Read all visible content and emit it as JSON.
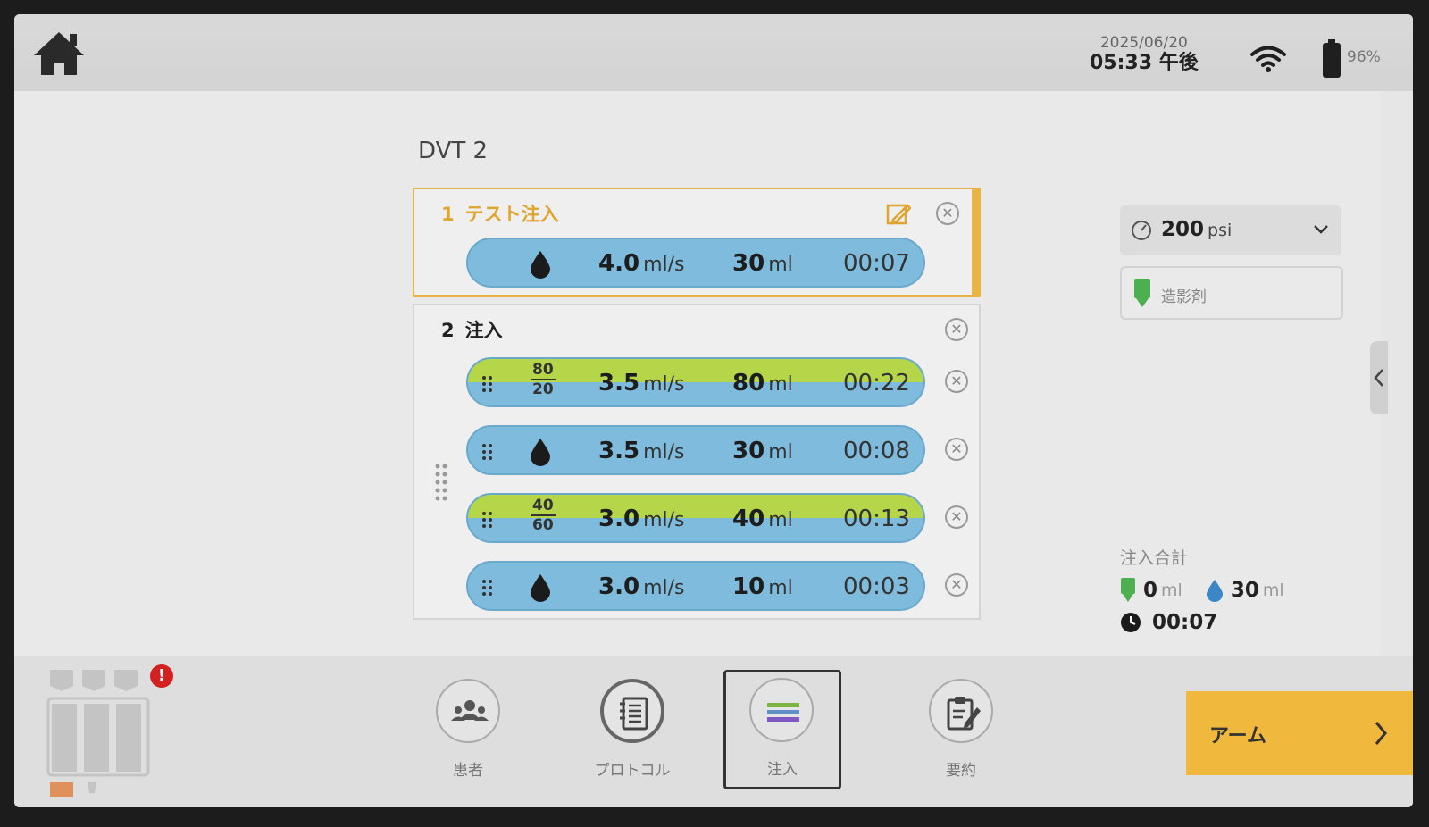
{
  "status_bar": {
    "date": "2025/06/20",
    "time": "05:33 午後",
    "battery": "96%"
  },
  "protocol": {
    "title": "DVT 2",
    "steps": [
      {
        "number": "1",
        "name": "テスト注入",
        "phases": [
          {
            "type": "saline",
            "rate": "4.0",
            "rate_unit": "ml/s",
            "volume": "30",
            "volume_unit": "ml",
            "duration": "00:07"
          }
        ]
      },
      {
        "number": "2",
        "name": "注入",
        "phases": [
          {
            "type": "dual",
            "ratio_top": "80",
            "ratio_bottom": "20",
            "rate": "3.5",
            "rate_unit": "ml/s",
            "volume": "80",
            "volume_unit": "ml",
            "duration": "00:22"
          },
          {
            "type": "saline",
            "rate": "3.5",
            "rate_unit": "ml/s",
            "volume": "30",
            "volume_unit": "ml",
            "duration": "00:08"
          },
          {
            "type": "dual",
            "ratio_top": "40",
            "ratio_bottom": "60",
            "rate": "3.0",
            "rate_unit": "ml/s",
            "volume": "40",
            "volume_unit": "ml",
            "duration": "00:13"
          },
          {
            "type": "saline",
            "rate": "3.0",
            "rate_unit": "ml/s",
            "volume": "10",
            "volume_unit": "ml",
            "duration": "00:03"
          }
        ]
      }
    ]
  },
  "pressure": {
    "value": "200",
    "unit": "psi"
  },
  "contrast_label": "造影剤",
  "totals": {
    "title": "注入合計",
    "contrast_volume": "0",
    "saline_volume": "30",
    "unit": "ml",
    "duration": "00:07"
  },
  "alert": "!",
  "nav": {
    "patient": "患者",
    "protocol": "プロトコル",
    "inject": "注入",
    "summary": "要約"
  },
  "arm_button": "アーム",
  "colors": {
    "accent_yellow": "#f0b83c",
    "saline_blue": "#7fbbdc",
    "contrast_green": "#b6d64a",
    "alert_red": "#d32020"
  }
}
